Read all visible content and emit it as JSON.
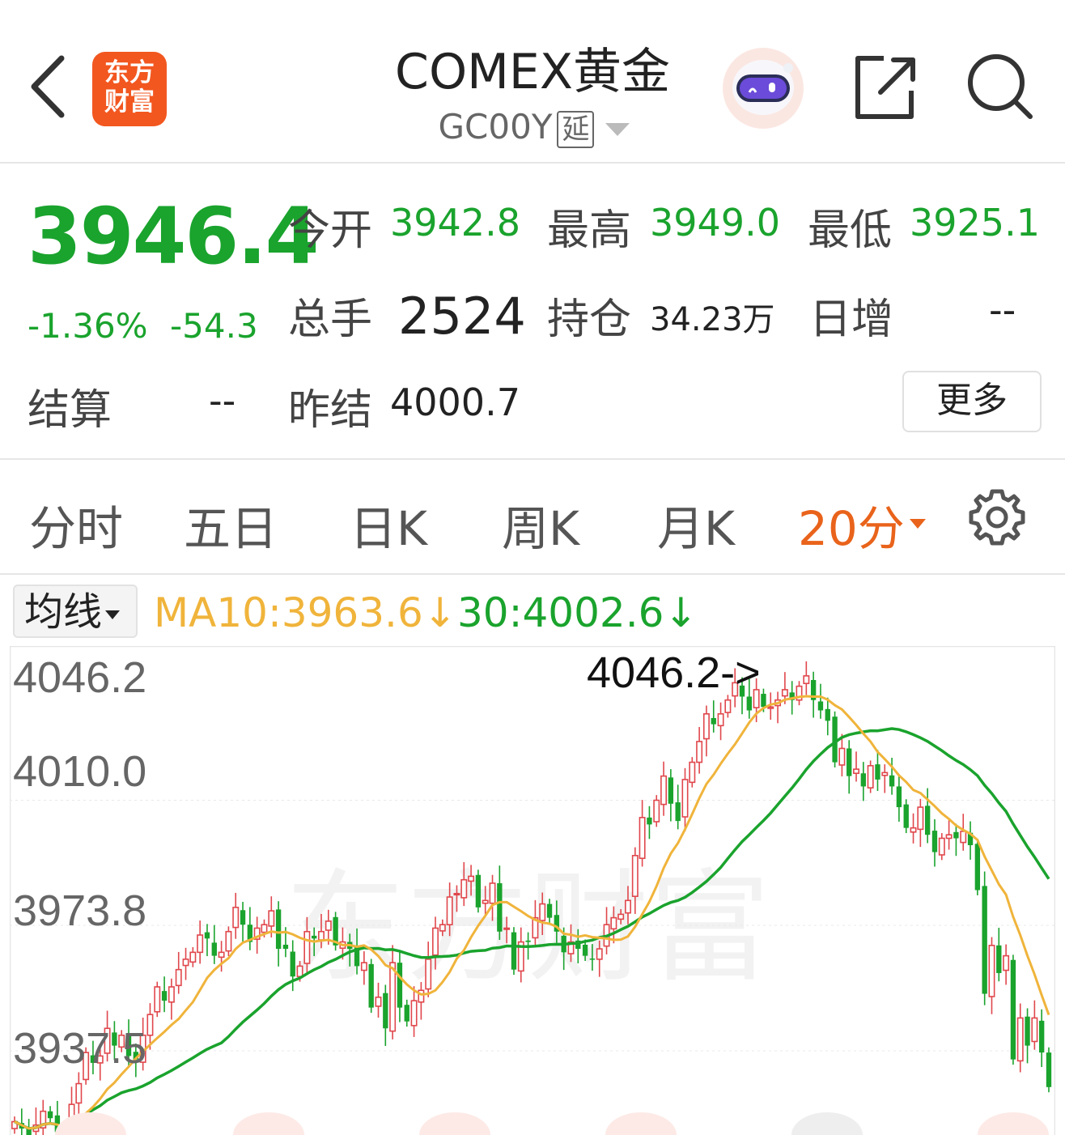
{
  "header": {
    "title": "COMEX黄金",
    "code": "GC00Y",
    "delay_badge": "延",
    "logo_line1": "东方",
    "logo_line2": "财富"
  },
  "quote": {
    "price": "3946.4",
    "change_pct": "-1.36%",
    "change_amt": "-54.3",
    "open_label": "今开",
    "open": "3942.8",
    "high_label": "最高",
    "high": "3949.0",
    "low_label": "最低",
    "low": "3925.1",
    "volume_label": "总手",
    "volume": "2524",
    "oi_label": "持仓",
    "oi": "34.23万",
    "daily_inc_label": "日增",
    "daily_inc": "--",
    "settle_label": "结算",
    "settle": "--",
    "prev_settle_label": "昨结",
    "prev_settle": "4000.7",
    "more": "更多"
  },
  "tabs": [
    "分时",
    "五日",
    "日K",
    "周K",
    "月K",
    "20分"
  ],
  "ma": {
    "select_label": "均线",
    "ma10": "MA10:3963.6↓",
    "ma30": "30:4002.6↓"
  },
  "chart_data": {
    "type": "candlestick",
    "y_ticks": [
      "4046.2",
      "4010.0",
      "3973.8",
      "3937.5"
    ],
    "max_marker": "4046.2->",
    "colors": {
      "up": "#e0474c",
      "down": "#1aa32d",
      "ma10": "#f0b43b",
      "ma30": "#1aa32d"
    },
    "watermark": "东方财富",
    "closes": [
      3917,
      3915,
      3913,
      3916,
      3920,
      3918,
      3914,
      3911,
      3922,
      3928,
      3937,
      3934,
      3936,
      3944,
      3939,
      3942,
      3936,
      3935,
      3942,
      3948,
      3956,
      3952,
      3956,
      3961,
      3964,
      3966,
      3971,
      3970,
      3965,
      3966,
      3972,
      3979,
      3974,
      3969,
      3973,
      3974,
      3978,
      3967,
      3967,
      3959,
      3962,
      3972,
      3970,
      3972,
      3975,
      3968,
      3969,
      3967,
      3962,
      3963,
      3950,
      3953,
      3944,
      3963,
      3950,
      3946,
      3952,
      3955,
      3964,
      3973,
      3974,
      3982,
      3983,
      3987,
      3988,
      3979,
      3981,
      3986,
      3972,
      3973,
      3961,
      3969,
      3969,
      3976,
      3980,
      3976,
      3972,
      3966,
      3969,
      3967,
      3965,
      3964,
      3967,
      3974,
      3976,
      3977,
      3981,
      3994,
      4005,
      4003,
      4010,
      4017,
      4009,
      4004,
      4016,
      4021,
      4027,
      4035,
      4032,
      4035,
      4039,
      4044,
      4040,
      4036,
      4042,
      4037,
      4037,
      4039,
      4042,
      4039,
      4043,
      4046,
      4039,
      4036,
      4033,
      4021,
      4025,
      4017,
      4019,
      4014,
      4020,
      4016,
      4018,
      4014,
      4008,
      4002,
      4002,
      4008,
      4000,
      3995,
      3999,
      4000,
      3999,
      4001,
      3997,
      3984,
      3954,
      3968,
      3960,
      3965,
      3935,
      3947,
      3939,
      3947,
      3937,
      3927
    ]
  }
}
